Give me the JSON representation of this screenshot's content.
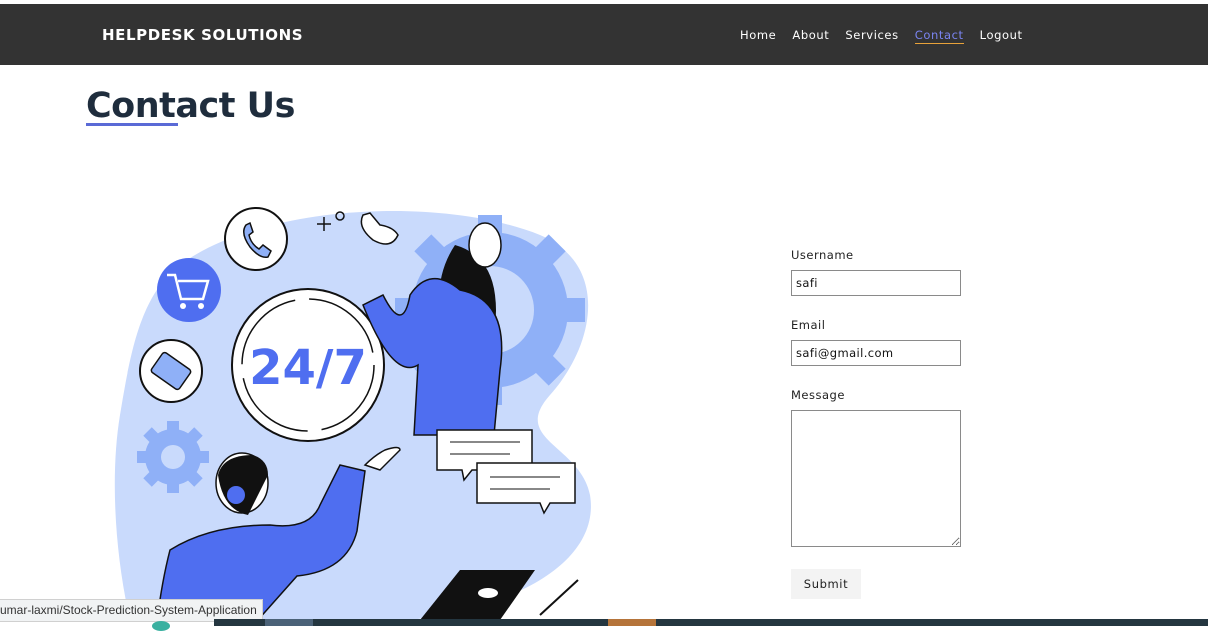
{
  "navbar": {
    "brand": "HELPDESK SOLUTIONS",
    "links": [
      "Home",
      "About",
      "Services",
      "Contact",
      "Logout"
    ],
    "active_link": "Contact"
  },
  "page": {
    "title": "Contact Us"
  },
  "illustration": {
    "badge_text": "24/7"
  },
  "form": {
    "username_label": "Username",
    "username_value": "safi",
    "email_label": "Email",
    "email_value": "safi@gmail.com",
    "message_label": "Message",
    "message_value": "",
    "submit_label": "Submit"
  },
  "status_bar": {
    "url_text": "umar-laxmi/Stock-Prediction-System-Application"
  },
  "colors": {
    "navbar_bg": "#333333",
    "active_link": "#7a84f0",
    "accent_blue": "#4f6ef0",
    "light_blue": "#c9dafc",
    "title_color": "#1f2d3d"
  }
}
